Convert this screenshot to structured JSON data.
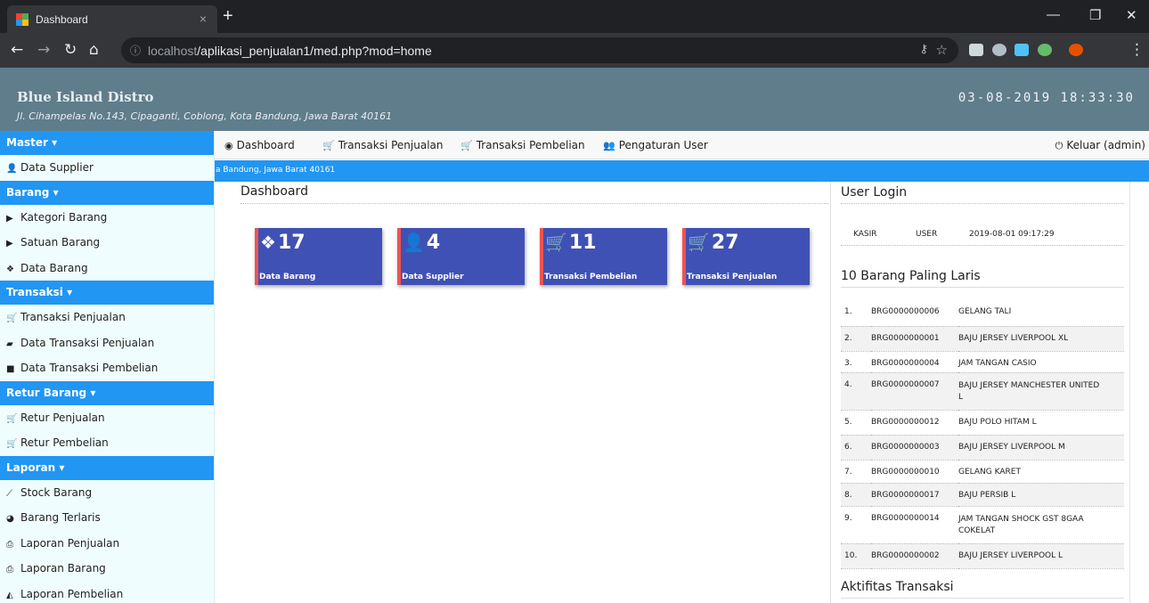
{
  "browser": {
    "tab_title": "Dashboard",
    "tab_close": "×",
    "new_tab": "+",
    "url_host": "localhost",
    "url_path": "/aplikasi_penjualan1/med.php?mod=home",
    "window_controls": [
      "—",
      "❐",
      "✕"
    ]
  },
  "header": {
    "brand": "Blue Island Distro",
    "address": "Jl. Cihampelas No.143, Cipaganti, Coblong, Kota Bandung, Jawa Barat 40161",
    "datetime": "03-08-2019 18:33:30"
  },
  "sidebar": {
    "groups": [
      {
        "title": "Master ▾",
        "items": [
          {
            "label": "Data Supplier",
            "icon": "user-icon"
          }
        ]
      },
      {
        "title": "Barang ▾",
        "items": [
          {
            "label": "Kategori Barang",
            "icon": "folder-icon"
          },
          {
            "label": "Satuan Barang",
            "icon": "folder-icon"
          },
          {
            "label": "Data Barang",
            "icon": "cubes-icon"
          }
        ]
      },
      {
        "title": "Transaksi ▾",
        "items": [
          {
            "label": "Transaksi Penjualan",
            "icon": "cart-icon"
          },
          {
            "label": "Data Transaksi Penjualan",
            "icon": "book-icon"
          },
          {
            "label": "Data Transaksi Pembelian",
            "icon": "truck-icon"
          }
        ]
      },
      {
        "title": "Retur Barang ▾",
        "items": [
          {
            "label": "Retur Penjualan",
            "icon": "cart-return-icon"
          },
          {
            "label": "Retur Pembelian",
            "icon": "cart-return-icon"
          }
        ]
      },
      {
        "title": "Laporan ▾",
        "items": [
          {
            "label": "Stock Barang",
            "icon": "line-chart-icon"
          },
          {
            "label": "Barang Terlaris",
            "icon": "pie-chart-icon"
          },
          {
            "label": "Laporan Penjualan",
            "icon": "print-icon"
          },
          {
            "label": "Laporan Barang",
            "icon": "print-icon"
          },
          {
            "label": "Laporan Pembelian",
            "icon": "area-chart-icon"
          }
        ]
      }
    ]
  },
  "topnav": {
    "dashboard": "Dashboard",
    "transaksi_penjualan": "Transaksi Penjualan",
    "transaksi_pembelian": "Transaksi Pembelian",
    "pengaturan_user": "Pengaturan User",
    "logout": "Keluar (admin)"
  },
  "marquee": "a Bandung, Jawa Barat 40161",
  "main": {
    "title": "Dashboard",
    "cards": [
      {
        "value": "17",
        "label": "Data Barang",
        "icon": "cubes-icon"
      },
      {
        "value": "4",
        "label": "Data Supplier",
        "icon": "user-icon"
      },
      {
        "value": "11",
        "label": "Transaksi Pembelian",
        "icon": "cart-icon"
      },
      {
        "value": "27",
        "label": "Transaksi Penjualan",
        "icon": "cart-icon"
      }
    ]
  },
  "panel": {
    "login_title": "User Login",
    "login": {
      "name": "KASIR",
      "role": "USER",
      "time": "2019-08-01 09:17:29"
    },
    "top_title": "10 Barang Paling Laris",
    "top_items": [
      {
        "no": "1.",
        "code": "BRG0000000006",
        "name": "GELANG TALI"
      },
      {
        "no": "2.",
        "code": "BRG0000000001",
        "name": "BAJU JERSEY LIVERPOOL XL"
      },
      {
        "no": "3.",
        "code": "BRG0000000004",
        "name": "JAM TANGAN CASIO"
      },
      {
        "no": "4.",
        "code": "BRG0000000007",
        "name": "BAJU JERSEY MANCHESTER UNITED L"
      },
      {
        "no": "5.",
        "code": "BRG0000000012",
        "name": "BAJU POLO HITAM L"
      },
      {
        "no": "6.",
        "code": "BRG0000000003",
        "name": "BAJU JERSEY LIVERPOOL M"
      },
      {
        "no": "7.",
        "code": "BRG0000000010",
        "name": "GELANG KARET"
      },
      {
        "no": "8.",
        "code": "BRG0000000017",
        "name": "BAJU PERSIB L"
      },
      {
        "no": "9.",
        "code": "BRG0000000014",
        "name": "JAM TANGAN SHOCK GST 8GAA COKELAT"
      },
      {
        "no": "10.",
        "code": "BRG0000000002",
        "name": "BAJU JERSEY LIVERPOOL L"
      }
    ],
    "activity_title": "Aktifitas Transaksi"
  }
}
